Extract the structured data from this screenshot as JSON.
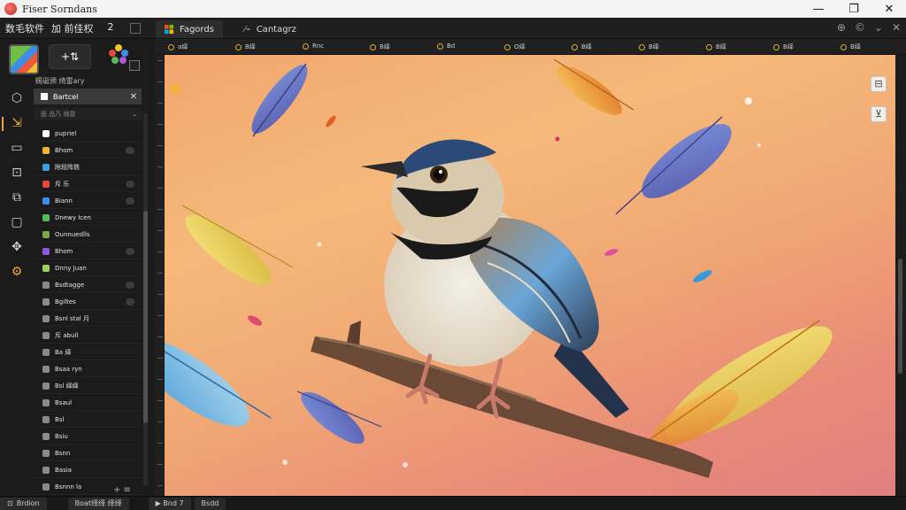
{
  "window": {
    "title": "Fiser Sorndans",
    "minimize": "—",
    "maximize": "❐",
    "close": "✕"
  },
  "menubar": {
    "menus": [
      "数毛软件",
      "加 前佳权"
    ],
    "count": "2",
    "tabs": [
      {
        "label": "Fagords",
        "active": true
      },
      {
        "label": "Cantagrz",
        "active": false
      }
    ],
    "tools": [
      "⊕",
      "©",
      "⌄",
      "✕"
    ]
  },
  "leftpanel": {
    "add_label": "+⇅",
    "header": "赐诞颁 绮雷ary",
    "selected_layer": "Bartcel",
    "sub_header": "面 品乃 绮雷",
    "items": [
      {
        "label": "pupriel",
        "color": "#ffffff",
        "toggle": false
      },
      {
        "label": "Bhom",
        "color": "#f2b233",
        "toggle": true
      },
      {
        "label": "附段阵铁",
        "color": "#3da0e0",
        "toggle": false
      },
      {
        "label": "斥 乐",
        "color": "#e04a3b",
        "toggle": true
      },
      {
        "label": "Biann",
        "color": "#3d8ee8",
        "toggle": true
      },
      {
        "label": "Dnewy Icen",
        "color": "#5cb85c",
        "toggle": false
      },
      {
        "label": "Ounnuedlls",
        "color": "#7aa84a",
        "toggle": false
      },
      {
        "label": "Bhom",
        "color": "#8a5ad8",
        "toggle": true
      },
      {
        "label": "Dnny Juan",
        "color": "#a0d060",
        "toggle": false
      },
      {
        "label": "Bsdtagge",
        "color": "#8a8a8a",
        "toggle": true
      },
      {
        "label": "Bgiltes",
        "color": "#8a8a8a",
        "toggle": true
      },
      {
        "label": "Bsnl stal 月",
        "color": "#8a8a8a",
        "toggle": false
      },
      {
        "label": "斥 abull",
        "color": "#8a8a8a",
        "toggle": false
      },
      {
        "label": "Ba 绎",
        "color": "#8a8a8a",
        "toggle": false
      },
      {
        "label": "Bsaa ryn",
        "color": "#8a8a8a",
        "toggle": false
      },
      {
        "label": "Bsl 绎绎",
        "color": "#8a8a8a",
        "toggle": false
      },
      {
        "label": "Bsaul",
        "color": "#8a8a8a",
        "toggle": false
      },
      {
        "label": "Bsl",
        "color": "#8a8a8a",
        "toggle": false
      },
      {
        "label": "Bsiu",
        "color": "#8a8a8a",
        "toggle": false
      },
      {
        "label": "Bsnn",
        "color": "#8a8a8a",
        "toggle": false
      },
      {
        "label": "Basia",
        "color": "#8a8a8a",
        "toggle": false
      },
      {
        "label": "Bsnnn la",
        "color": "#8a8a8a",
        "toggle": false
      }
    ],
    "footer": "+ ≡"
  },
  "ruler_tabs": [
    "a绎",
    "B绎",
    "Rnc",
    "B绎",
    "Bd",
    "O绎",
    "B绎",
    "B绎",
    "B绎",
    "B绎",
    "B绎"
  ],
  "statusbar": [
    "Brdion",
    "Boat绎绎 绎绎",
    "▶ Bnd 7",
    "Bsdd"
  ],
  "colors": {
    "accent": "#f1a53b",
    "canvas_top": "#f5b97a",
    "canvas_bottom": "#e27f80"
  }
}
